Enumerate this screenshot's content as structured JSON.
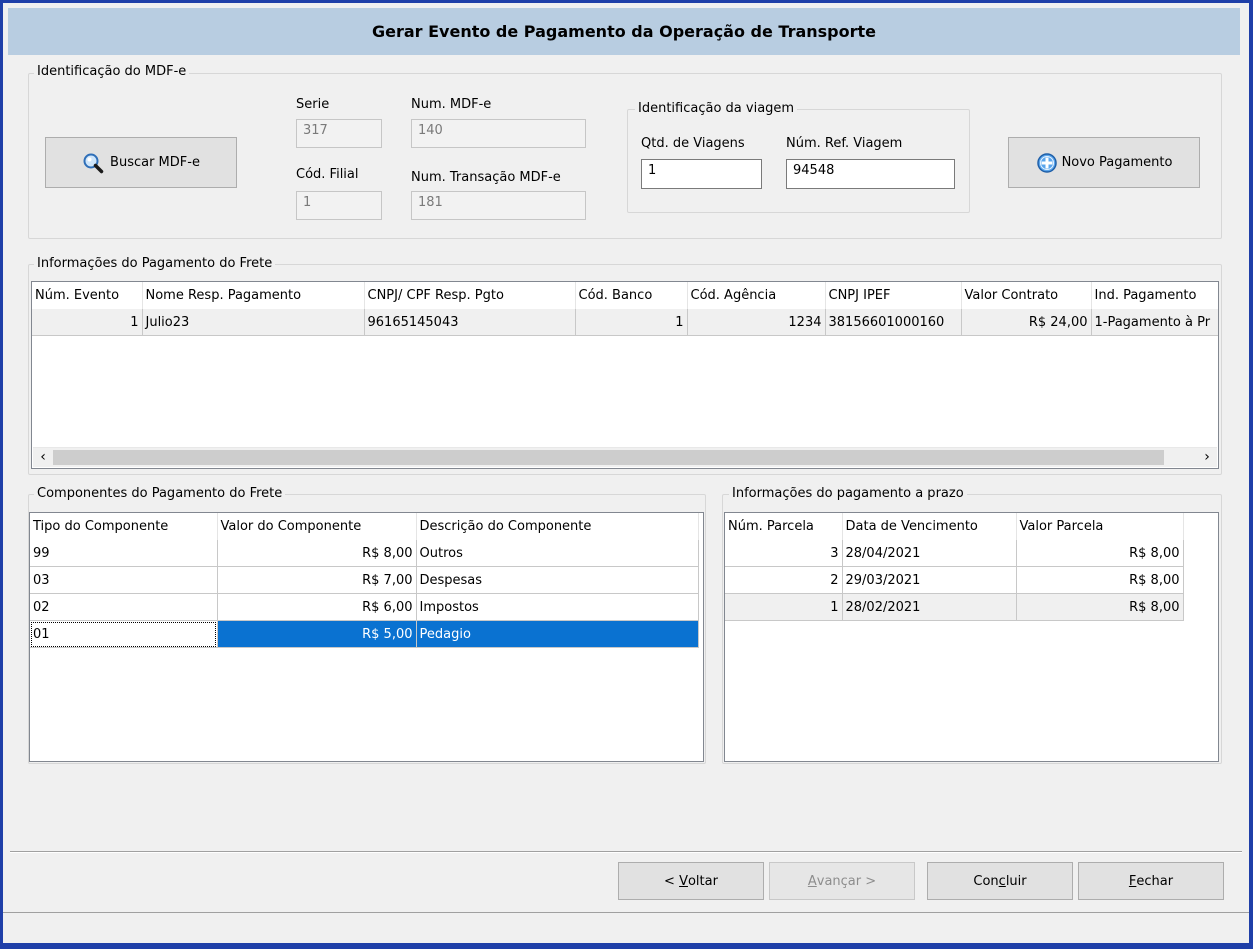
{
  "window": {
    "title": "Gerar Evento de Pagamento da Operação de Transporte"
  },
  "mdfe": {
    "legend": "Identificação do MDF-e",
    "buscar_label": "Buscar MDF-e",
    "serie_label": "Serie",
    "serie_value": "317",
    "num_mdfe_label": "Num. MDF-e",
    "num_mdfe_value": "140",
    "cod_filial_label": "Cód. Filial",
    "cod_filial_value": "1",
    "num_transacao_label": "Num. Transação MDF-e",
    "num_transacao_value": "181",
    "viagem": {
      "legend": "Identificação da viagem",
      "qtd_label": "Qtd. de Viagens",
      "qtd_value": "1",
      "ref_label": "Núm. Ref. Viagem",
      "ref_value": "94548"
    },
    "novo_pagamento_label": "Novo Pagamento"
  },
  "frete": {
    "legend": "Informações do Pagamento do Frete",
    "columns": [
      "Núm. Evento",
      "Nome Resp. Pagamento",
      "CNPJ/ CPF Resp. Pgto",
      "Cód. Banco",
      "Cód. Agência",
      "CNPJ IPEF",
      "Valor Contrato",
      "Ind. Pagamento"
    ],
    "rows": [
      [
        "1",
        "Julio23",
        "96165145043",
        "1",
        "1234",
        "38156601000160",
        "R$ 24,00",
        "1-Pagamento à Pr"
      ]
    ]
  },
  "componentes": {
    "legend": "Componentes do Pagamento do Frete",
    "columns": [
      "Tipo do Componente",
      "Valor do Componente",
      "Descrição do Componente"
    ],
    "rows": [
      [
        "99",
        "R$ 8,00",
        "Outros"
      ],
      [
        "03",
        "R$ 7,00",
        "Despesas"
      ],
      [
        "02",
        "R$ 6,00",
        "Impostos"
      ],
      [
        "01",
        "R$ 5,00",
        "Pedagio"
      ]
    ]
  },
  "prazo": {
    "legend": "Informações do pagamento a prazo",
    "columns": [
      "Núm. Parcela",
      "Data de Vencimento",
      "Valor Parcela"
    ],
    "rows": [
      [
        "3",
        "28/04/2021",
        "R$ 8,00"
      ],
      [
        "2",
        "29/03/2021",
        "R$ 8,00"
      ],
      [
        "1",
        "28/02/2021",
        "R$ 8,00"
      ]
    ]
  },
  "footer": {
    "voltar_pre": "< ",
    "voltar_key": "V",
    "voltar_rest": "oltar",
    "avancar_key": "A",
    "avancar_rest": "vançar >",
    "concluir_pre": "Con",
    "concluir_key": "c",
    "concluir_rest": "luir",
    "fechar_key": "F",
    "fechar_rest": "echar"
  },
  "colors": {
    "title_bar": "#b8cde1",
    "selection": "#0a72d1",
    "frame": "#1f3fa8"
  },
  "icons": {
    "buscar": "magnifier-icon",
    "novo_pagamento": "plus-circle-icon"
  }
}
